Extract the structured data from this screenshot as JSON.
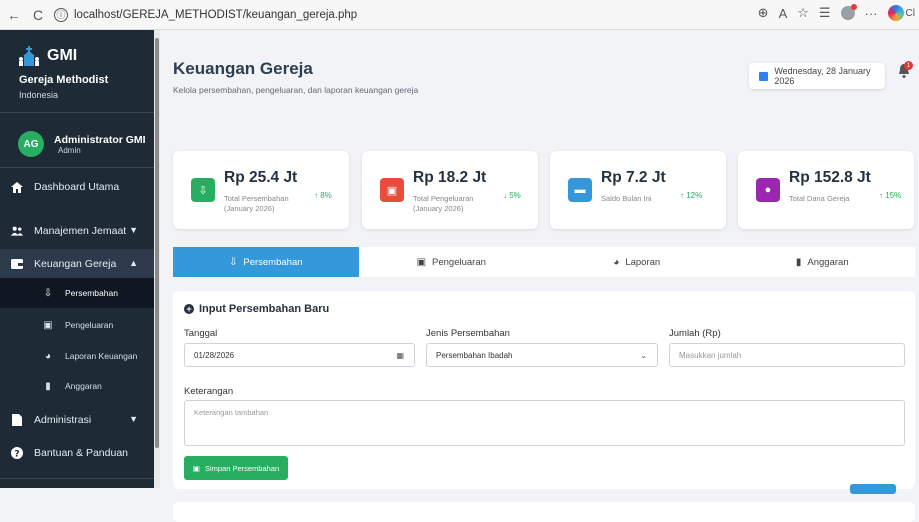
{
  "browser": {
    "url": "localhost/GEREJA_METHODIST/keuangan_gereja.php",
    "back": "←",
    "reload": "C",
    "info": "ⓘ",
    "copilot_text": "Cl"
  },
  "sidebar": {
    "brand": "GMI",
    "subtitle": "Gereja Methodist",
    "country": "Indonesia",
    "user": {
      "initials": "AG",
      "name": "Administrator GMI",
      "role": "Admin"
    },
    "menu": [
      {
        "label": "Dashboard Utama",
        "icon": "home-icon"
      },
      {
        "label": "Manajemen Jemaat",
        "icon": "users-icon"
      },
      {
        "label": "Keuangan Gereja",
        "icon": "wallet-icon"
      },
      {
        "label": "Administrasi",
        "icon": "file-icon"
      },
      {
        "label": "Bantuan & Panduan",
        "icon": "help-icon"
      }
    ],
    "submenu": [
      {
        "label": "Persembahan",
        "icon": "hand-holding-icon"
      },
      {
        "label": "Pengeluaran",
        "icon": "money-bill-icon"
      },
      {
        "label": "Laporan Keuangan",
        "icon": "pie-chart-icon"
      },
      {
        "label": "Anggaran",
        "icon": "file-invoice-icon"
      }
    ]
  },
  "header": {
    "title": "Keuangan Gereja",
    "description": "Kelola persembahan, pengeluaran, dan laporan keuangan gereja",
    "date": "Wednesday, 28 January 2026",
    "notification_count": "1"
  },
  "stats": [
    {
      "value": "Rp 25.4 Jt",
      "label": "Total Persembahan (January 2026)",
      "trend": "↑ 8%",
      "color": "#27ae60",
      "icon": "hand-holding-icon"
    },
    {
      "value": "Rp 18.2 Jt",
      "label": "Total Pengeluaran (January 2026)",
      "trend": "↓ 5%",
      "color": "#e74c3c",
      "icon": "money-bill-icon"
    },
    {
      "value": "Rp 7.2 Jt",
      "label": "Saldo Bulan Ini",
      "trend": "↑ 12%",
      "color": "#3498db",
      "icon": "wallet-icon"
    },
    {
      "value": "Rp 152.8 Jt",
      "label": "Total Dana Gereja",
      "trend": "↑ 15%",
      "color": "#9b27b0",
      "icon": "piggy-bank-icon"
    }
  ],
  "tabs": [
    {
      "label": "Persembahan",
      "icon": "hand-holding-icon"
    },
    {
      "label": "Pengeluaran",
      "icon": "money-bill-icon"
    },
    {
      "label": "Laporan",
      "icon": "pie-chart-icon"
    },
    {
      "label": "Anggaran",
      "icon": "file-invoice-icon"
    }
  ],
  "form": {
    "title": "Input Persembahan Baru",
    "tanggal_label": "Tanggal",
    "tanggal_value": "01/28/2026",
    "jenis_label": "Jenis Persembahan",
    "jenis_value": "Persembahan Ibadah",
    "jumlah_label": "Jumlah (Rp)",
    "jumlah_placeholder": "Masukkan jumlah",
    "keterangan_label": "Keterangan",
    "keterangan_placeholder": "Keterangan tambahan",
    "save_label": "Simpan Persembahan"
  }
}
